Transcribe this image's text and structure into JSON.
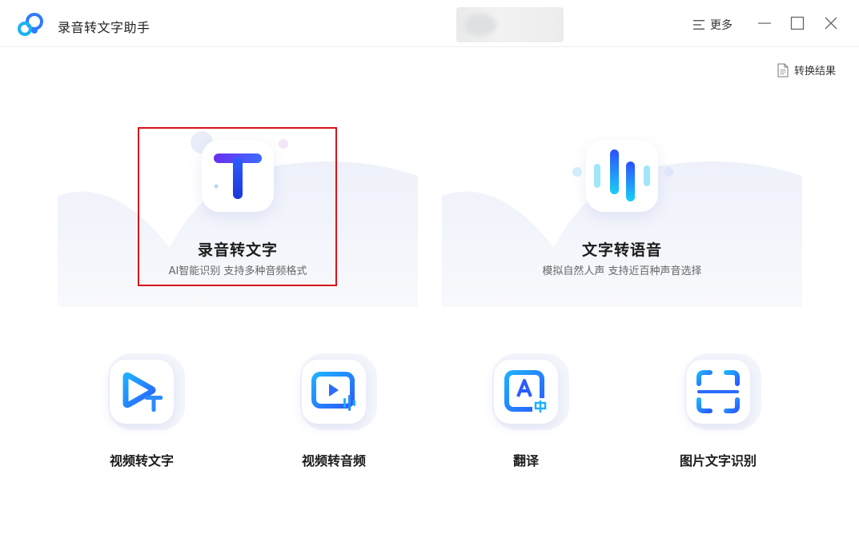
{
  "app": {
    "title": "录音转文字助手"
  },
  "header": {
    "more_label": "更多"
  },
  "toolbar": {
    "results_label": "转换结果"
  },
  "cards": [
    {
      "id": "record-to-text",
      "title": "录音转文字",
      "subtitle": "AI智能识别 支持多种音频格式",
      "selected": true,
      "icon": "text-t-icon"
    },
    {
      "id": "text-to-speech",
      "title": "文字转语音",
      "subtitle": "模拟自然人声 支持近百种声音选择",
      "selected": false,
      "icon": "sound-wave-icon"
    }
  ],
  "tools": [
    {
      "id": "video-to-text",
      "label": "视频转文字",
      "icon": "video-text-icon"
    },
    {
      "id": "video-to-audio",
      "label": "视频转音频",
      "icon": "video-audio-icon"
    },
    {
      "id": "translate",
      "label": "翻译",
      "icon": "translate-icon"
    },
    {
      "id": "image-ocr",
      "label": "图片文字识别",
      "icon": "scan-icon"
    }
  ],
  "colors": {
    "accent_blue": "#2f6bff",
    "accent_cyan": "#19c5f0",
    "accent_purple": "#6a3cf0",
    "highlight_red": "#d8141a",
    "card_bg": "#f4f6fb"
  }
}
